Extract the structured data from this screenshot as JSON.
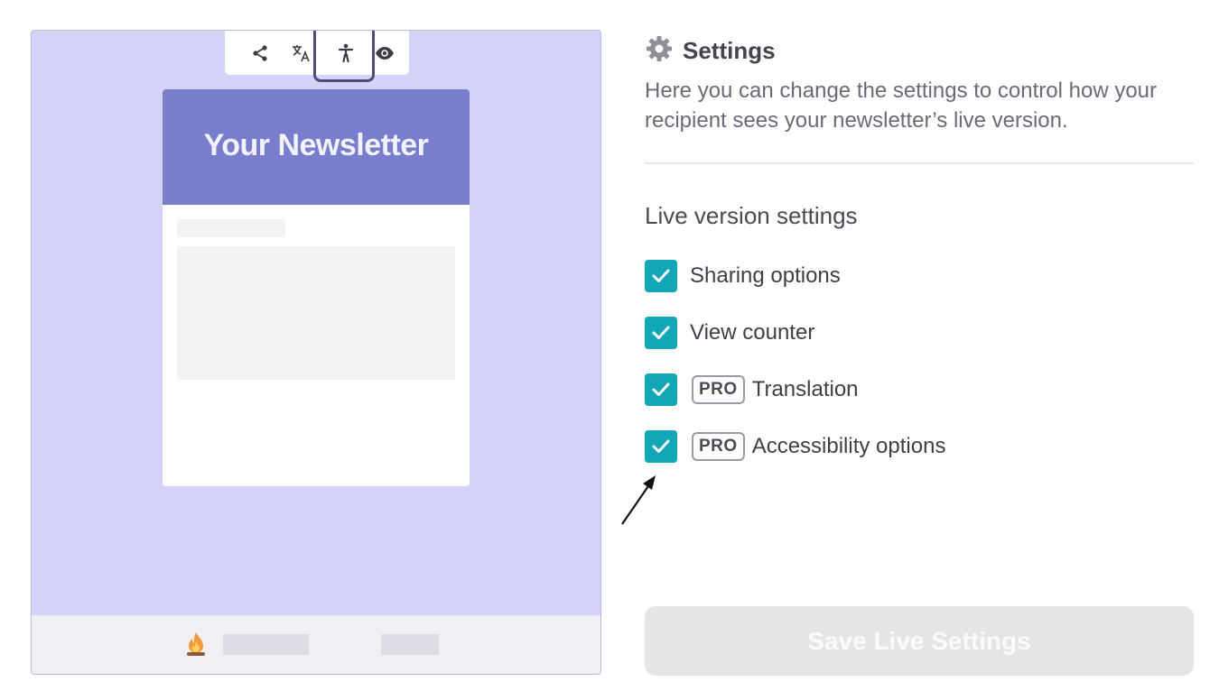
{
  "preview": {
    "toolbar": {
      "icons": [
        "share-icon",
        "translate-icon",
        "accessibility-icon",
        "eye-icon"
      ],
      "highlighted": "accessibility-icon"
    },
    "newsletter_title": "Your Newsletter",
    "header_color": "#787dcc",
    "background_color": "#d5d2fa"
  },
  "settings": {
    "title": "Settings",
    "description": "Here you can change the settings to control how your recipient sees your newsletter’s live version.",
    "section_title": "Live version settings",
    "options": [
      {
        "label": "Sharing options",
        "checked": true,
        "pro": false
      },
      {
        "label": "View counter",
        "checked": true,
        "pro": false
      },
      {
        "label": "Translation",
        "checked": true,
        "pro": true,
        "badge": "PRO"
      },
      {
        "label": "Accessibility options",
        "checked": true,
        "pro": true,
        "badge": "PRO"
      }
    ],
    "save_label": "Save Live Settings",
    "accent_color": "#13a6b6"
  }
}
